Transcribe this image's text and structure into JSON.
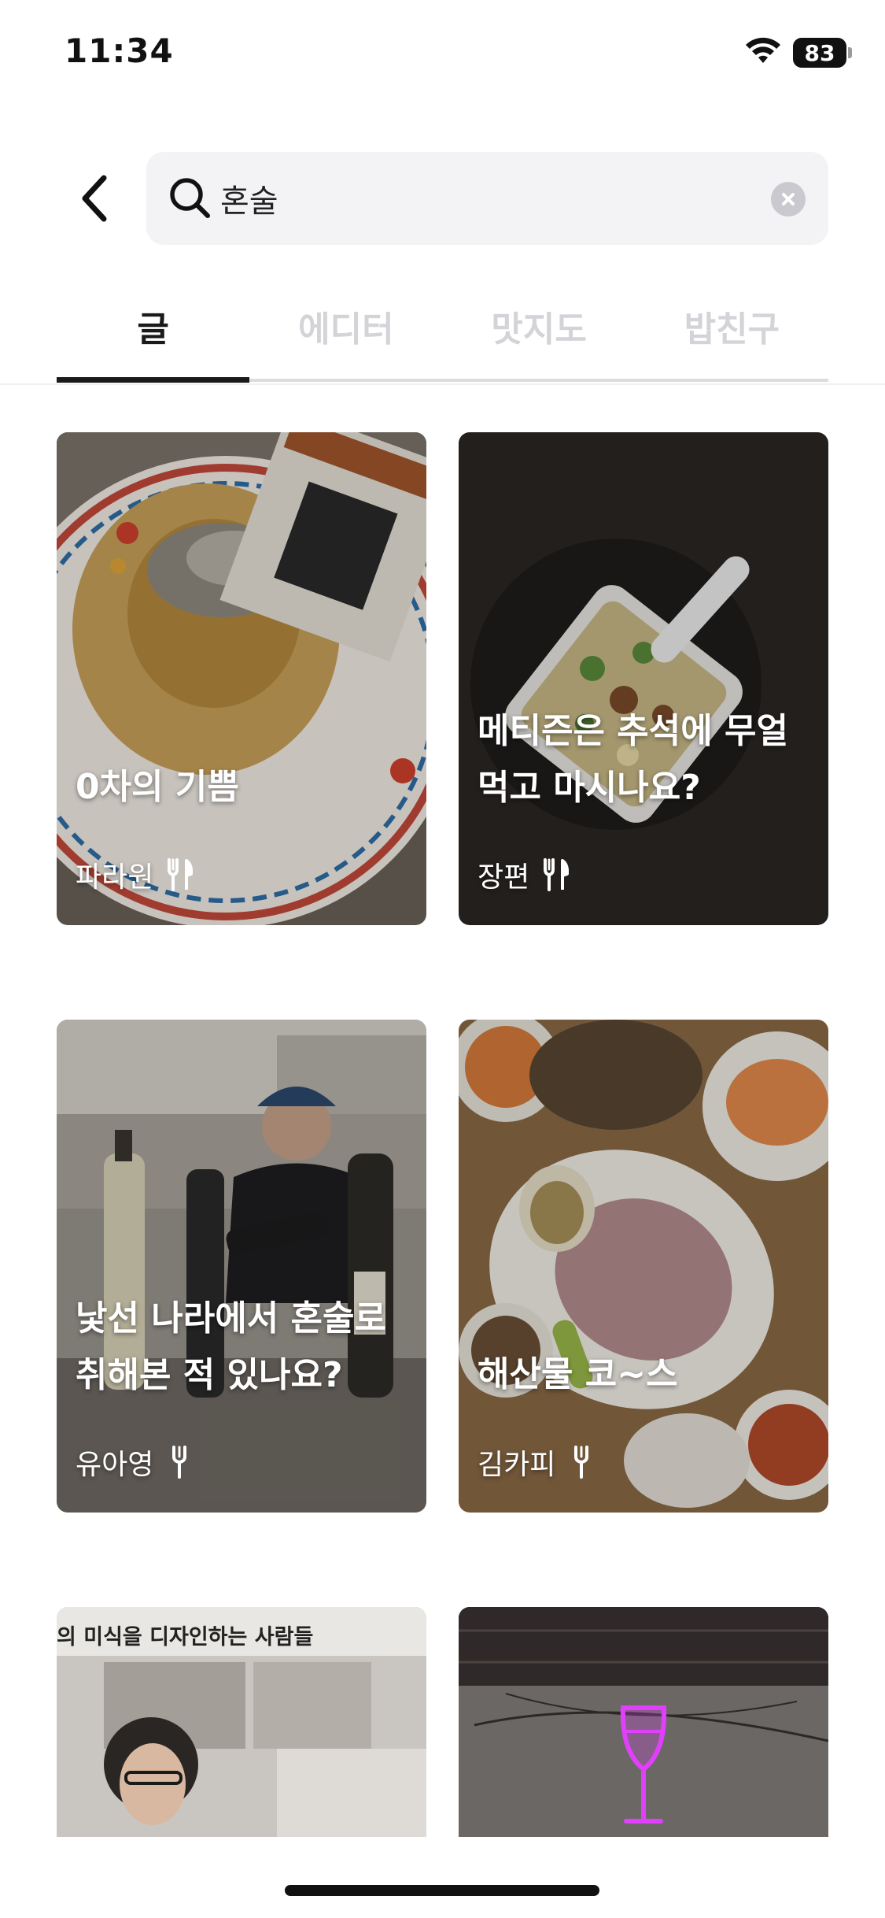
{
  "status_bar": {
    "time": "11:34",
    "battery": "83",
    "icons": [
      "wifi-icon",
      "battery-icon"
    ]
  },
  "search": {
    "query": "혼술",
    "placeholder": "",
    "icons": [
      "back-chevron-icon",
      "search-icon",
      "clear-icon"
    ]
  },
  "tabs": [
    {
      "label": "글",
      "active": true
    },
    {
      "label": "에디터",
      "active": false
    },
    {
      "label": "맛지도",
      "active": false
    },
    {
      "label": "밥친구",
      "active": false
    }
  ],
  "cards": [
    {
      "title": "0차의 기쁨",
      "author": "파라원",
      "icon": "fork-knife-icon"
    },
    {
      "title": "메티즌은 추석에 무얼\n먹고 마시나요?",
      "author": "장편",
      "icon": "fork-knife-icon"
    },
    {
      "title": "낯선 나라에서 혼술로\n취해본 적 있나요?",
      "author": "유아영",
      "icon": "fork-icon"
    },
    {
      "title": "해산물 코~스",
      "author": "김카피",
      "icon": "fork-icon"
    },
    {
      "caption": "의 미식을 디자인하는 사람들"
    },
    {
      "icon": "neon-wine-glass-icon"
    }
  ],
  "colors": {
    "active_tab": "#1a1a1a",
    "inactive_tab": "#d3d3d8",
    "search_bg": "#f3f3f5",
    "neon": "#e040fb"
  }
}
